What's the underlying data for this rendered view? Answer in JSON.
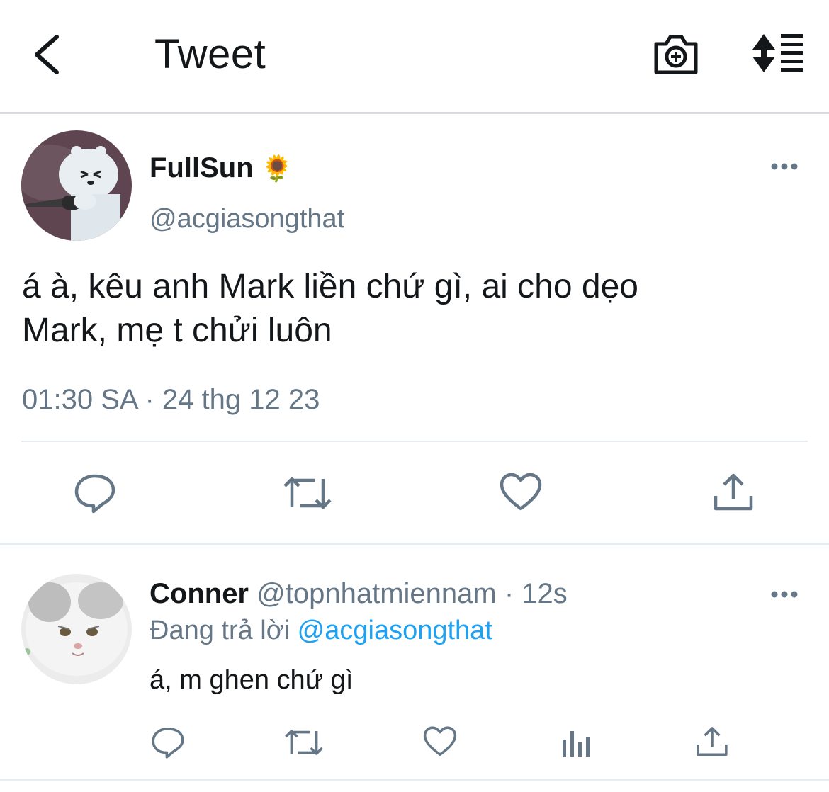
{
  "header": {
    "title": "Tweet",
    "icons": [
      "back-chevron-icon",
      "camera-plus-icon",
      "sort-list-icon"
    ]
  },
  "tweet": {
    "author_name": "FullSun",
    "author_emoji": "🌻",
    "author_handle": "@acgiasongthat",
    "text_line1": "á à, kêu anh Mark liền chứ gì, ai cho dẹo",
    "text_line2": "Mark, mẹ t chửi luôn",
    "timestamp": "01:30 SA · 24 thg 12 23",
    "actions": [
      "reply-icon",
      "retweet-icon",
      "like-icon",
      "share-icon"
    ]
  },
  "reply": {
    "author_name": "Conner",
    "author_handle": "@topnhatmiennam",
    "time": "· 12s",
    "replying_prefix": "Đang trả lời",
    "replying_to": "@acgiasongthat",
    "text": "á, m ghen chứ gì",
    "actions": [
      "reply-icon",
      "retweet-icon",
      "like-icon",
      "analytics-icon",
      "share-icon"
    ]
  },
  "colors": {
    "text": "#14171a",
    "secondary": "#657786",
    "link": "#1da1f2",
    "divider": "#e6ecf0"
  }
}
